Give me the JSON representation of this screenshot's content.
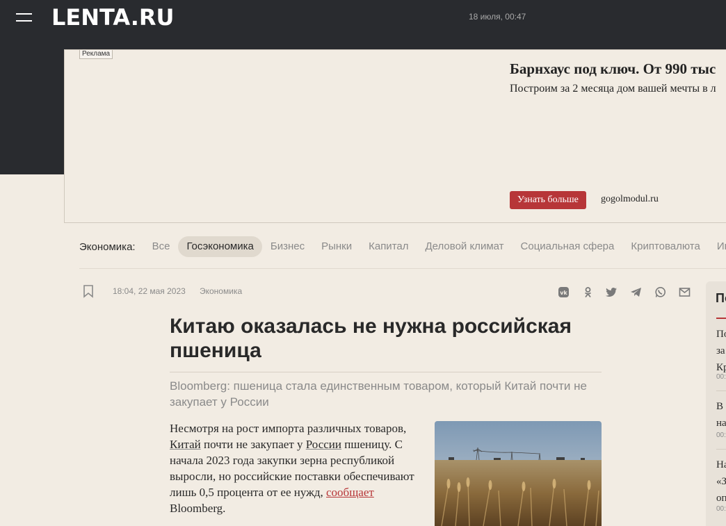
{
  "header": {
    "logo": "LENTA.RU",
    "date": "18 июля, 00:47"
  },
  "ad": {
    "label": "Реклама",
    "title": "Барнхаус под ключ. От 990 тыс",
    "description": "Построим за 2 месяца дом вашей мечты в л",
    "button": "Узнать больше",
    "domain": "gogolmodul.ru",
    "button_color": "#b73638"
  },
  "rubrics": {
    "title": "Экономика:",
    "items": [
      "Все",
      "Госэкономика",
      "Бизнес",
      "Рынки",
      "Капитал",
      "Деловой климат",
      "Социальная сфера",
      "Криптовалюта",
      "Ин"
    ],
    "active": "Госэкономика"
  },
  "article": {
    "time": "18:04, 22 мая 2023",
    "rubric": "Экономика",
    "share_icons": [
      "vk-icon",
      "ok-icon",
      "twitter-icon",
      "telegram-icon",
      "whatsapp-icon",
      "mail-icon"
    ],
    "title": "Китаю оказалась не нужна российская пшеница",
    "lead": "Bloomberg: пшеница стала единственным товаром, который Китай почти не закупает у России",
    "body": {
      "p1_a": "Несмотря на рост импорта различных товаров, ",
      "link_china": "Китай",
      "p1_b": " почти не закупает у ",
      "link_russia": "России",
      "p1_c": " пшеницу. С начала 2023 года закупки зерна республикой выросли, но российские поставки обеспечивают лишь 0,5 процента от ее нужд, ",
      "link_reports": "сообщает",
      "p1_d": " Bloomberg."
    }
  },
  "sidebar": {
    "title": "По",
    "items": [
      {
        "lines": [
          "По",
          "за",
          "Кр"
        ],
        "time": "00:"
      },
      {
        "lines": [
          "В",
          "на"
        ],
        "time": "00:"
      },
      {
        "lines": [
          "На",
          "«З",
          "оп"
        ],
        "time": "00:"
      }
    ]
  }
}
